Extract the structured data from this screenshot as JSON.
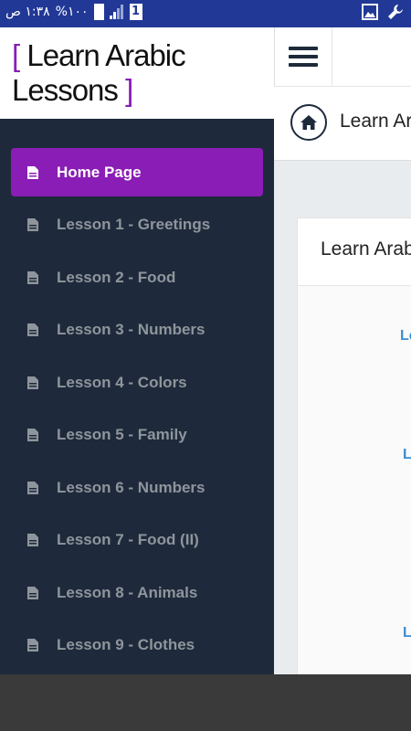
{
  "status_bar": {
    "time": "١:٣٨ ص",
    "battery_text": "%١٠٠",
    "sim_label": "1"
  },
  "brand": {
    "open_bracket": "[",
    "line1": "Learn Arabic",
    "line2": "Lessons",
    "close_bracket": "]",
    "accent_color": "#8a1db5"
  },
  "sidebar": {
    "items": [
      {
        "label": "Home Page",
        "icon": "file-icon",
        "active": true
      },
      {
        "label": "Lesson 1 - Greetings",
        "icon": "file-icon"
      },
      {
        "label": "Lesson 2 - Food",
        "icon": "file-icon"
      },
      {
        "label": "Lesson 3 - Numbers",
        "icon": "file-icon"
      },
      {
        "label": "Lesson 4 - Colors",
        "icon": "file-icon"
      },
      {
        "label": "Lesson 5 - Family",
        "icon": "file-icon"
      },
      {
        "label": "Lesson 6 - Numbers",
        "icon": "file-icon"
      },
      {
        "label": "Lesson 7 - Food (II)",
        "icon": "file-icon"
      },
      {
        "label": "Lesson 8 - Animals",
        "icon": "file-icon"
      },
      {
        "label": "Lesson 9 - Clothes",
        "icon": "file-icon"
      }
    ]
  },
  "header": {
    "menu_icon": "hamburger-icon",
    "breadcrumb_icon": "home-icon",
    "breadcrumb_title": "Learn Ar"
  },
  "card": {
    "title": "Learn Arabi",
    "links": [
      "Le",
      "L",
      "L"
    ]
  },
  "colors": {
    "sidebar_bg": "#1e2a3b",
    "active_bg": "#8a1db5",
    "link_color": "#3c8dd0",
    "status_bar_bg": "#213896"
  }
}
